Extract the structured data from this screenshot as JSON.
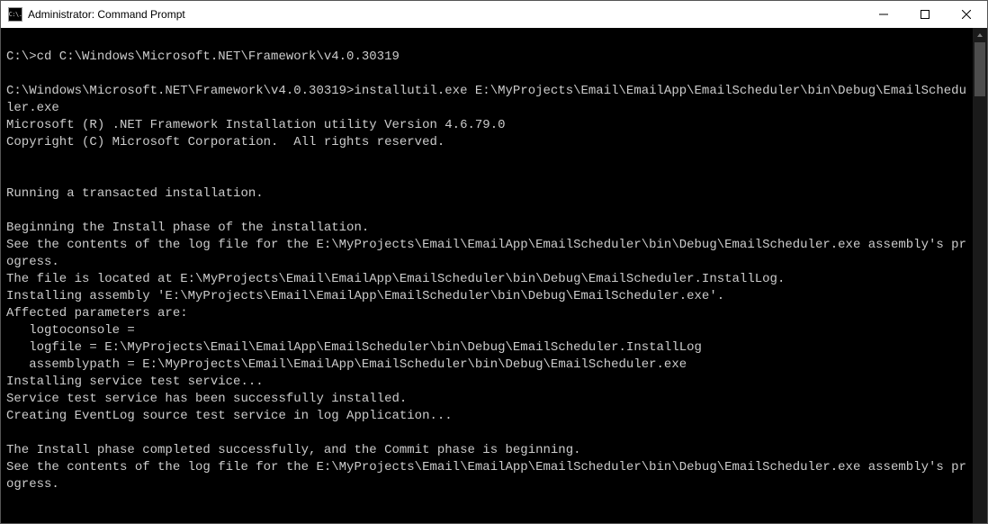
{
  "titlebar": {
    "icon_text": "C:\\.",
    "title": "Administrator: Command Prompt"
  },
  "console": {
    "lines": [
      "",
      "C:\\>cd C:\\Windows\\Microsoft.NET\\Framework\\v4.0.30319",
      "",
      "C:\\Windows\\Microsoft.NET\\Framework\\v4.0.30319>installutil.exe E:\\MyProjects\\Email\\EmailApp\\EmailScheduler\\bin\\Debug\\EmailScheduler.exe",
      "Microsoft (R) .NET Framework Installation utility Version 4.6.79.0",
      "Copyright (C) Microsoft Corporation.  All rights reserved.",
      "",
      "",
      "Running a transacted installation.",
      "",
      "Beginning the Install phase of the installation.",
      "See the contents of the log file for the E:\\MyProjects\\Email\\EmailApp\\EmailScheduler\\bin\\Debug\\EmailScheduler.exe assembly's progress.",
      "The file is located at E:\\MyProjects\\Email\\EmailApp\\EmailScheduler\\bin\\Debug\\EmailScheduler.InstallLog.",
      "Installing assembly 'E:\\MyProjects\\Email\\EmailApp\\EmailScheduler\\bin\\Debug\\EmailScheduler.exe'.",
      "Affected parameters are:",
      "   logtoconsole =",
      "   logfile = E:\\MyProjects\\Email\\EmailApp\\EmailScheduler\\bin\\Debug\\EmailScheduler.InstallLog",
      "   assemblypath = E:\\MyProjects\\Email\\EmailApp\\EmailScheduler\\bin\\Debug\\EmailScheduler.exe",
      "Installing service test service...",
      "Service test service has been successfully installed.",
      "Creating EventLog source test service in log Application...",
      "",
      "The Install phase completed successfully, and the Commit phase is beginning.",
      "See the contents of the log file for the E:\\MyProjects\\Email\\EmailApp\\EmailScheduler\\bin\\Debug\\EmailScheduler.exe assembly's progress."
    ]
  }
}
